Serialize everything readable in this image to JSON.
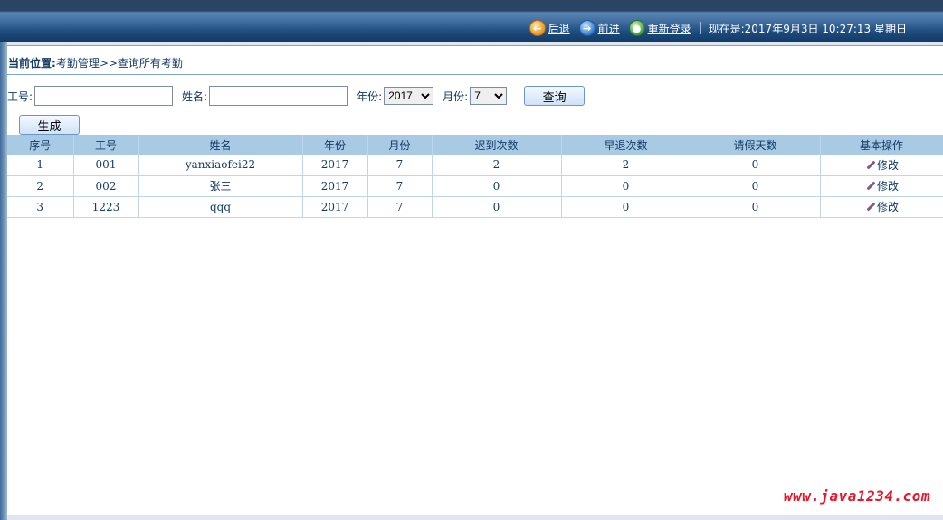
{
  "nav": {
    "back_label": "后退",
    "forward_label": "前进",
    "relogin_label": "重新登录",
    "current_time": "现在是:2017年9月3日  10:27:13 星期日"
  },
  "breadcrumb": {
    "label": "当前位置:",
    "path": "考勤管理>>查询所有考勤"
  },
  "search": {
    "empno_label": "工号:",
    "empno_value": "",
    "name_label": "姓名:",
    "name_value": "",
    "year_label": "年份:",
    "year_selected": "2017",
    "month_label": "月份:",
    "month_selected": "7",
    "query_button": "查询"
  },
  "generate_button": "生成",
  "table": {
    "headers": [
      "序号",
      "工号",
      "姓名",
      "年份",
      "月份",
      "迟到次数",
      "早退次数",
      "请假天数",
      "基本操作"
    ],
    "rows": [
      [
        "1",
        "001",
        "yanxiaofei22",
        "2017",
        "7",
        "2",
        "2",
        "0",
        "修改"
      ],
      [
        "2",
        "002",
        "张三",
        "2017",
        "7",
        "0",
        "0",
        "0",
        "修改"
      ],
      [
        "3",
        "1223",
        "qqq",
        "2017",
        "7",
        "0",
        "0",
        "0",
        "修改"
      ]
    ]
  },
  "watermark": "www.java1234.com",
  "icons": {
    "back": "back-arrow-icon",
    "forward": "forward-arrow-icon",
    "relogin": "relogin-icon",
    "edit": "pencil-icon"
  }
}
